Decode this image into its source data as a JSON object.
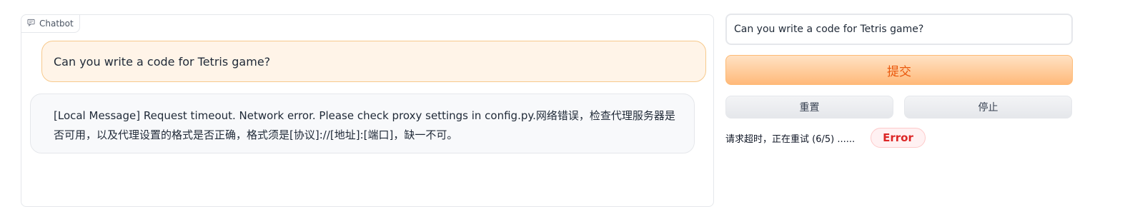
{
  "chatbot": {
    "label": "Chatbot",
    "icon": "chat-icon",
    "messages": [
      {
        "role": "user",
        "text": "Can you write a code for Tetris game?"
      },
      {
        "role": "bot",
        "text": "[Local Message] Request timeout. Network error. Please check proxy settings in config.py.网络错误，检查代理服务器是否可用，以及代理设置的格式是否正确，格式须是[协议]://[地址]:[端口]，缺一不可。"
      }
    ]
  },
  "sidebar": {
    "input_value": "Can you write a code for Tetris game?",
    "submit_label": "提交",
    "reset_label": "重置",
    "stop_label": "停止",
    "status_text": "请求超时，正在重试 (6/5) ......",
    "error_label": "Error"
  },
  "colors": {
    "accent": "#ea580c",
    "user_bubble": "#fff4e8",
    "error": "#dc2626"
  }
}
